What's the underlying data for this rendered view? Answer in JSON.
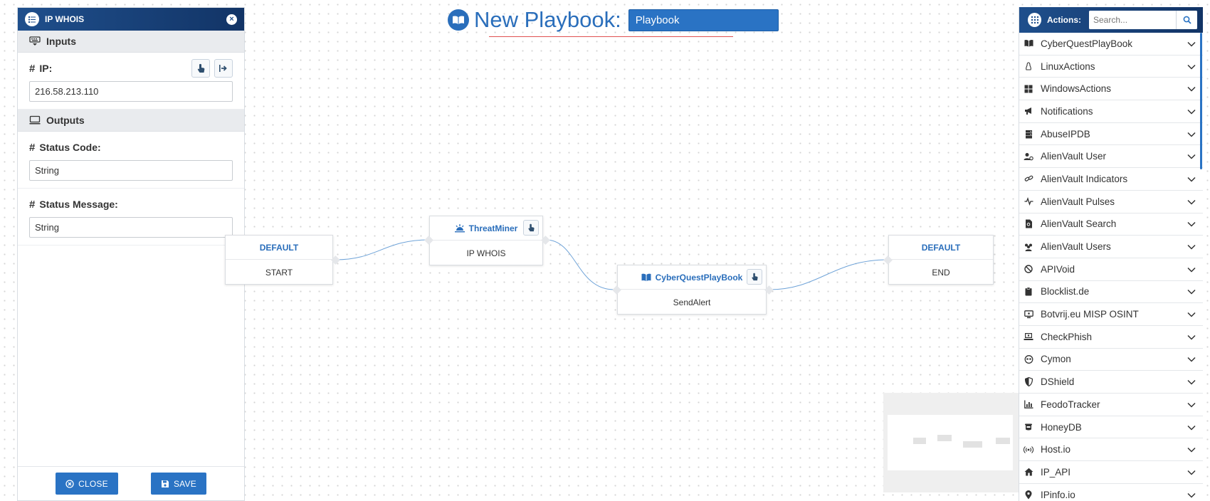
{
  "left_panel": {
    "title": "IP WHOIS",
    "inputs_label": "Inputs",
    "ip_label": "IP:",
    "ip_value": "216.58.213.110",
    "outputs_label": "Outputs",
    "status_code_label": "Status Code:",
    "status_code_value": "String",
    "status_message_label": "Status Message:",
    "status_message_value": "String",
    "close_label": "CLOSE",
    "save_label": "SAVE"
  },
  "header": {
    "title": "New Playbook:",
    "playbook_name": "Playbook"
  },
  "nodes": {
    "start": {
      "header": "DEFAULT",
      "body": "START"
    },
    "threatminer": {
      "header": "ThreatMiner",
      "body": "IP WHOIS"
    },
    "cyberquest": {
      "header": "CyberQuestPlayBook",
      "body": "SendAlert"
    },
    "end": {
      "header": "DEFAULT",
      "body": "END"
    }
  },
  "actions_panel": {
    "title": "Actions:",
    "search_placeholder": "Search...",
    "items": [
      {
        "label": "CyberQuestPlayBook",
        "icon": "book-icon"
      },
      {
        "label": "LinuxActions",
        "icon": "linux-icon"
      },
      {
        "label": "WindowsActions",
        "icon": "windows-icon"
      },
      {
        "label": "Notifications",
        "icon": "bullhorn-icon"
      },
      {
        "label": "AbuseIPDB",
        "icon": "server-icon"
      },
      {
        "label": "AlienVault User",
        "icon": "user-cog-icon"
      },
      {
        "label": "AlienVault Indicators",
        "icon": "link-icon"
      },
      {
        "label": "AlienVault Pulses",
        "icon": "pulse-icon"
      },
      {
        "label": "AlienVault Search",
        "icon": "file-search-icon"
      },
      {
        "label": "AlienVault Users",
        "icon": "users-icon"
      },
      {
        "label": "APIVoid",
        "icon": "ban-icon"
      },
      {
        "label": "Blocklist.de",
        "icon": "clipboard-icon"
      },
      {
        "label": "Botvrij.eu MISP OSINT",
        "icon": "monitor-icon"
      },
      {
        "label": "CheckPhish",
        "icon": "laptop-icon"
      },
      {
        "label": "Cymon",
        "icon": "mask-icon"
      },
      {
        "label": "DShield",
        "icon": "shield-icon"
      },
      {
        "label": "FeodoTracker",
        "icon": "chart-icon"
      },
      {
        "label": "HoneyDB",
        "icon": "pot-icon"
      },
      {
        "label": "Host.io",
        "icon": "broadcast-icon"
      },
      {
        "label": "IP_API",
        "icon": "house-icon"
      },
      {
        "label": "IPinfo.io",
        "icon": "map-pin-icon"
      }
    ]
  },
  "colors": {
    "brand_blue": "#2a6ebb",
    "header_dark": "#123466",
    "button_blue": "#2a73c4"
  }
}
